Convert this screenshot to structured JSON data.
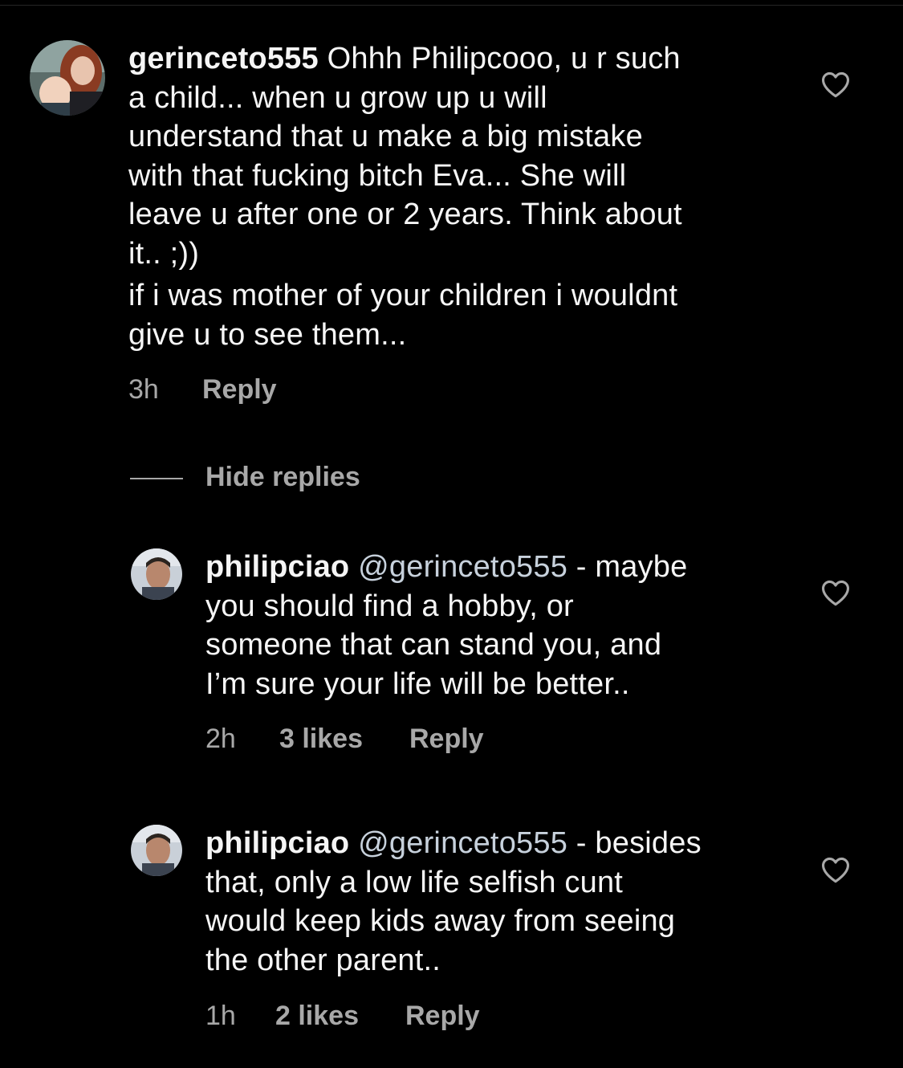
{
  "comments": [
    {
      "username": "gerinceto555",
      "lines": [
        "Ohhh Philipcooo, u r such",
        "a child... when u grow up u will",
        "understand that u make a big mistake",
        "with that fucking bitch Eva... She will",
        "leave u after one or 2 years. Think about",
        "it.. ;))",
        "if i was mother of your children i wouldnt",
        "give u to see them..."
      ],
      "time": "3h",
      "reply_label": "Reply"
    }
  ],
  "hide_replies_label": "Hide replies",
  "replies": [
    {
      "username": "philipciao",
      "mention": "@gerinceto555",
      "lines": [
        "- maybe",
        "you should find a hobby, or",
        "someone that can stand you, and",
        "I’m sure your life will be better.."
      ],
      "time": "2h",
      "likes": "3 likes",
      "reply_label": "Reply"
    },
    {
      "username": "philipciao",
      "mention": "@gerinceto555",
      "lines": [
        "- besides",
        "that, only a low life selfish cunt",
        "would keep kids away from seeing",
        "the other parent.."
      ],
      "time": "1h",
      "likes": "2 likes",
      "reply_label": "Reply"
    }
  ],
  "colors": {
    "background": "#000000",
    "text": "#f5f5f5",
    "secondary": "#a8a8a8",
    "mention": "#c7d1dc"
  },
  "icons": {
    "like": "heart-outline-icon"
  }
}
